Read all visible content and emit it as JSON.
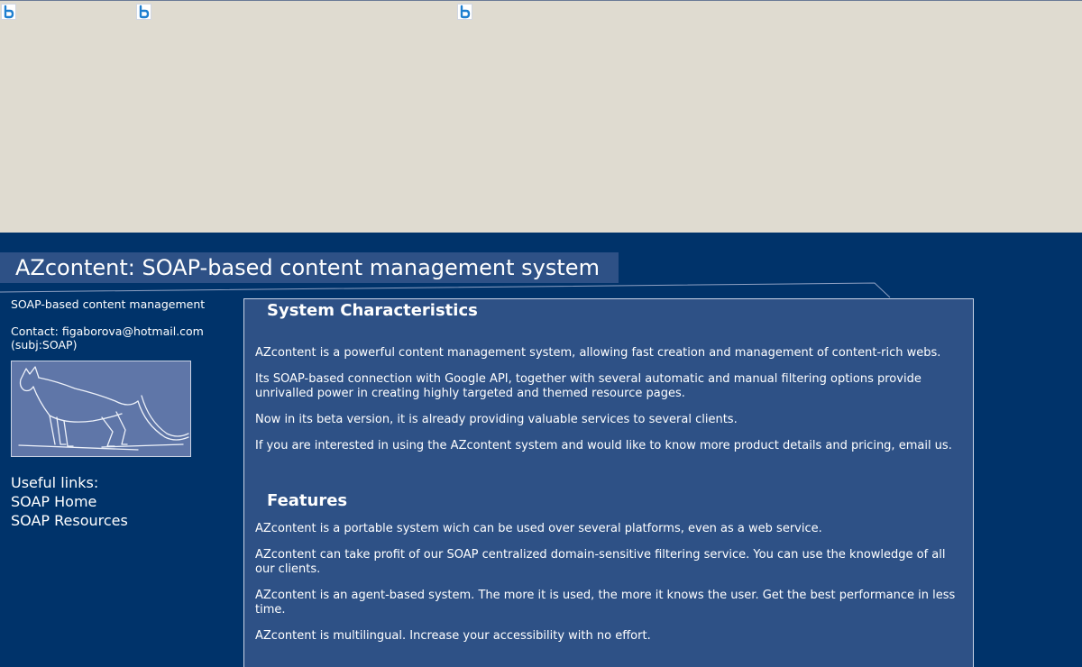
{
  "header": {
    "title": "AZcontent: SOAP-based content management system"
  },
  "sidebar": {
    "tagline": "SOAP-based content management",
    "contact_line1": "Contact: figaborova@hotmail.com",
    "contact_line2": "(subj:SOAP)",
    "useful_links_title": "Useful links:",
    "links": [
      "SOAP Home",
      "SOAP Resources"
    ]
  },
  "content": {
    "characteristics": {
      "title": "System Characteristics",
      "paragraphs": [
        "AZcontent is a powerful content management system, allowing fast creation and management of content-rich webs.",
        "Its SOAP-based connection with Google API, together with several automatic and manual filtering options provide unrivalled power in creating highly targeted and themed resource pages.",
        "Now in its beta version, it is already providing valuable services to several clients.",
        "If you are interested in using the AZcontent system and would like to know more product details and pricing, email us."
      ]
    },
    "features": {
      "title": "Features",
      "paragraphs": [
        "AZcontent is a portable system wich can be used over several platforms, even as a web service.",
        "AZcontent can take profit of our SOAP centralized domain-sensitive filtering service. You can use the knowledge of all our clients.",
        "AZcontent is an agent-based system. The more it is used, the more it knows the user. Get the best performance in less time.",
        "AZcontent is multilingual. Increase your accessibility with no effort."
      ]
    }
  },
  "icons": {
    "ad_placeholder": "b-logo-icon",
    "sidebar_image": "cat-sketch-image"
  },
  "colors": {
    "page_bg": "#00336a",
    "panel_bg": "#2e5186",
    "top_band": "#dfdbd0"
  }
}
